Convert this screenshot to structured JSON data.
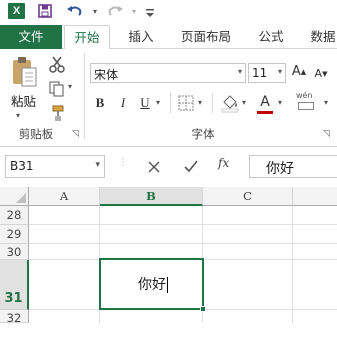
{
  "qat": {
    "logo_text": "X"
  },
  "tabs": [
    "文件",
    "开始",
    "插入",
    "页面布局",
    "公式",
    "数据"
  ],
  "ribbon": {
    "paste_label": "粘贴",
    "clipboard_group": "剪贴板",
    "font_group": "字体",
    "font_name": "宋体",
    "font_size": "11",
    "bold": "B",
    "italic": "I",
    "underline": "U",
    "font_color_letter": "A",
    "phonetic_label": "wén",
    "grow_font": "A",
    "shrink_font": "A",
    "font_color": "#c00000"
  },
  "formula_bar": {
    "name_box": "B31",
    "fx": "fx",
    "content": "你好"
  },
  "grid": {
    "columns": [
      "A",
      "B",
      "C"
    ],
    "rows": [
      "28",
      "29",
      "30",
      "31",
      "32"
    ],
    "active_cell_value": "你好",
    "accent": "#217346"
  }
}
